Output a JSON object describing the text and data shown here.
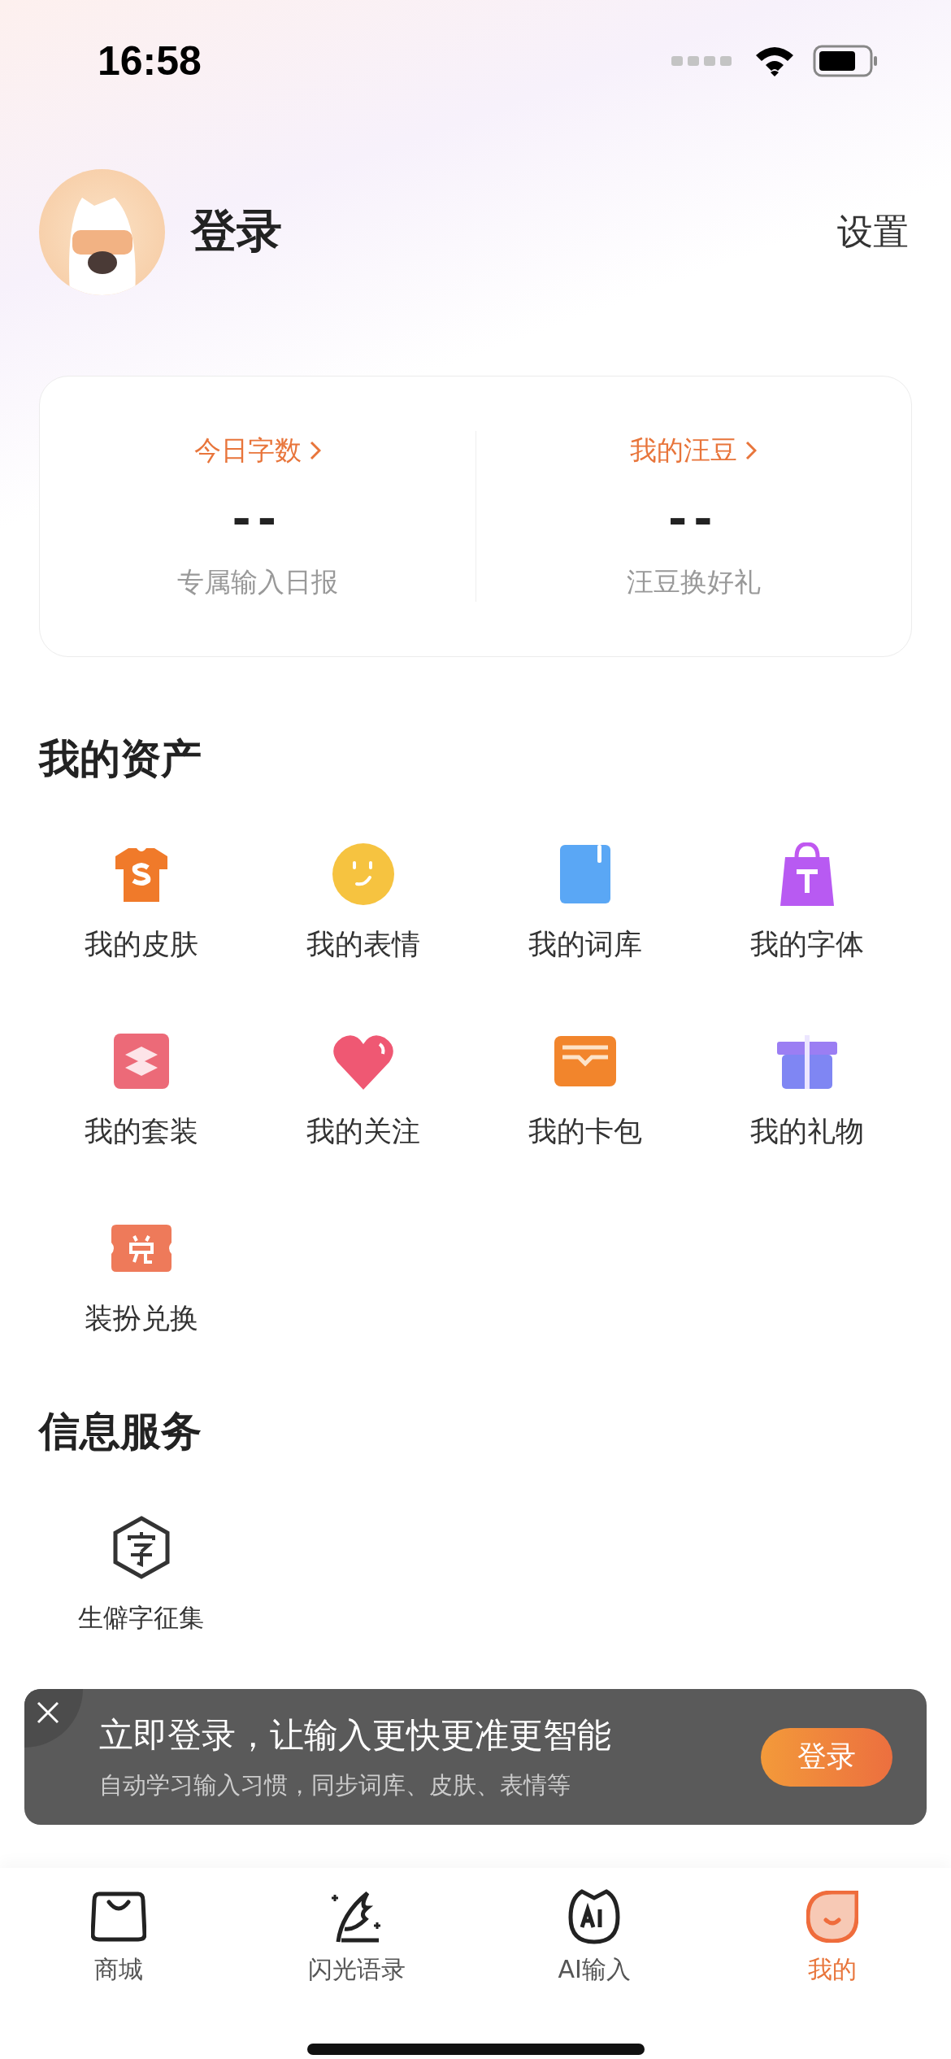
{
  "status_bar": {
    "time": "16:58"
  },
  "profile": {
    "name": "登录",
    "settings": "设置"
  },
  "stats": [
    {
      "title": "今日字数",
      "value": "--",
      "caption": "专属输入日报"
    },
    {
      "title": "我的汪豆",
      "value": "--",
      "caption": "汪豆换好礼"
    }
  ],
  "assets": {
    "title": "我的资产",
    "items": [
      {
        "label": "我的皮肤",
        "kind": "shirt"
      },
      {
        "label": "我的表情",
        "kind": "smile"
      },
      {
        "label": "我的词库",
        "kind": "book"
      },
      {
        "label": "我的字体",
        "kind": "font"
      },
      {
        "label": "我的套装",
        "kind": "layers"
      },
      {
        "label": "我的关注",
        "kind": "heart"
      },
      {
        "label": "我的卡包",
        "kind": "wallet"
      },
      {
        "label": "我的礼物",
        "kind": "gift"
      },
      {
        "label": "装扮兑换",
        "kind": "ticket"
      }
    ]
  },
  "services": {
    "title": "信息服务",
    "items": [
      {
        "label": "生僻字征集",
        "kind": "hexagon"
      }
    ]
  },
  "login_banner": {
    "title": "立即登录，让输入更快更准更智能",
    "subtitle": "自动学习输入习惯，同步词库、皮肤、表情等",
    "button": "登录"
  },
  "tab_bar": [
    {
      "label": "商城",
      "kind": "bag",
      "selected": false
    },
    {
      "label": "闪光语录",
      "kind": "quill",
      "selected": false
    },
    {
      "label": "AI输入",
      "kind": "ai",
      "selected": false
    },
    {
      "label": "我的",
      "kind": "me",
      "selected": true
    }
  ]
}
